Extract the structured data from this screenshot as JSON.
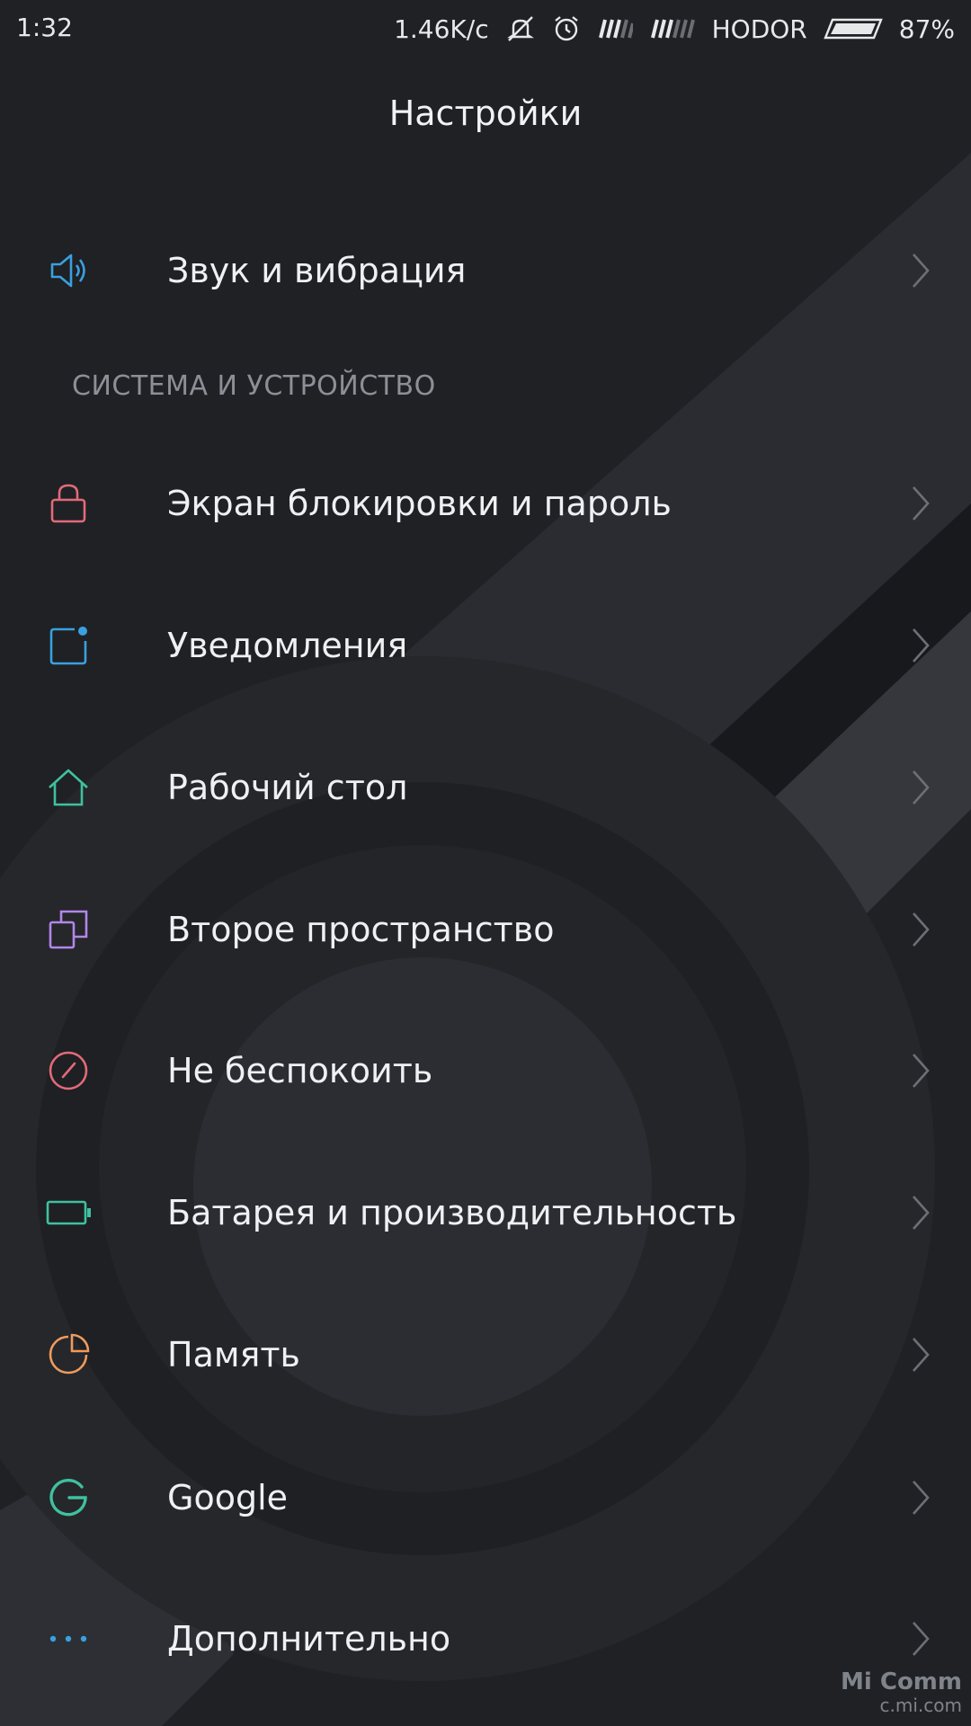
{
  "status_bar": {
    "time": "1:32",
    "speed": "1.46K/c",
    "carrier": "HODOR",
    "battery": "87%",
    "icons": [
      "mute-icon",
      "alarm-icon",
      "signal-icon",
      "signal-icon",
      "battery-icon"
    ]
  },
  "header": {
    "title": "Настройки"
  },
  "top_item": {
    "label": "Звук и вибрация",
    "icon": "speaker-icon",
    "color": "#3aa0e0"
  },
  "section": {
    "title": "СИСТЕМА И УСТРОЙСТВО"
  },
  "items": [
    {
      "label": "Экран блокировки и пароль",
      "icon": "lock-icon",
      "color": "#e36a78"
    },
    {
      "label": "Уведомления",
      "icon": "notification-icon",
      "color": "#3aa0e0"
    },
    {
      "label": "Рабочий стол",
      "icon": "home-icon",
      "color": "#3fc1a0"
    },
    {
      "label": "Второе пространство",
      "icon": "second-space-icon",
      "color": "#b386e8"
    },
    {
      "label": "Не беспокоить",
      "icon": "do-not-disturb-icon",
      "color": "#e36a78"
    },
    {
      "label": "Батарея и производительность",
      "icon": "battery-performance-icon",
      "color": "#3fc1a0"
    },
    {
      "label": "Память",
      "icon": "storage-icon",
      "color": "#f09a5c"
    },
    {
      "label": "Google",
      "icon": "google-icon",
      "color": "#3fc1a0"
    },
    {
      "label": "Дополнительно",
      "icon": "more-icon",
      "color": "#3aa0e0"
    }
  ],
  "watermark": {
    "line1": "Mi Comm",
    "line2": "c.mi.com"
  }
}
